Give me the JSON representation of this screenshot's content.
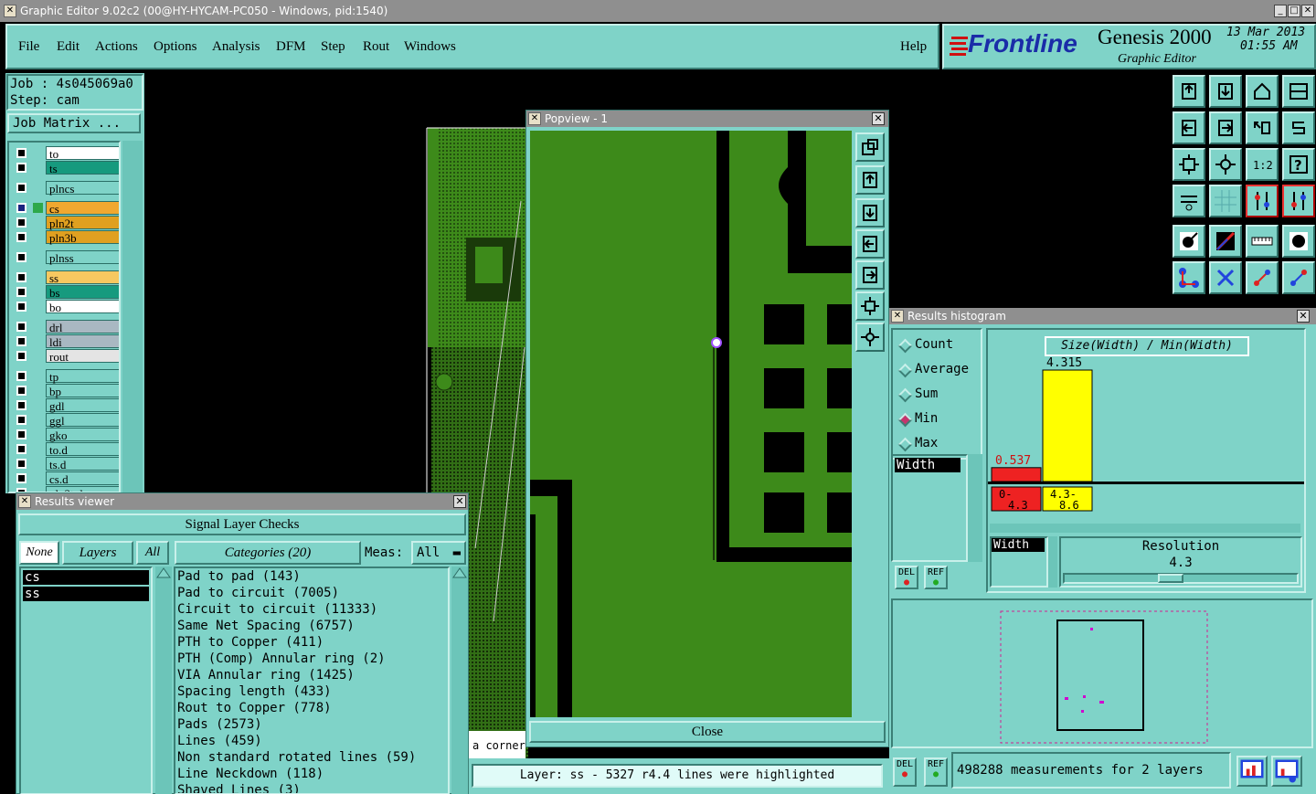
{
  "window": {
    "title": "Graphic Editor 9.02c2 (00@HY-HYCAM-PC050 - Windows, pid:1540)"
  },
  "menu": {
    "file": "File",
    "edit": "Edit",
    "actions": "Actions",
    "options": "Options",
    "analysis": "Analysis",
    "dfm": "DFM",
    "step": "Step",
    "rout": "Rout",
    "windows": "Windows",
    "help": "Help"
  },
  "brand": {
    "logo": "Frontline",
    "product": "Genesis 2000",
    "subtitle": "Graphic Editor",
    "date": "13 Mar 2013",
    "time": "01:55 AM"
  },
  "job": {
    "job_label": "Job : 4s045069a0",
    "step_label": "Step: cam",
    "matrix_button": "Job Matrix ..."
  },
  "layers": [
    {
      "name": "to",
      "color": "#ffffff",
      "selected": false
    },
    {
      "name": "ts",
      "color": "#169a7e",
      "selected": false
    },
    {
      "name": "plncs",
      "color": "#7fd3c8",
      "selected": false
    },
    {
      "name": "cs",
      "color": "#f0a830",
      "selected": true
    },
    {
      "name": "pln2t",
      "color": "#e0a020",
      "selected": false
    },
    {
      "name": "pln3b",
      "color": "#e0a020",
      "selected": false
    },
    {
      "name": "plnss",
      "color": "#7fd3c8",
      "selected": false
    },
    {
      "name": "ss",
      "color": "#f7c860",
      "selected": false
    },
    {
      "name": "bs",
      "color": "#169a7e",
      "selected": false
    },
    {
      "name": "bo",
      "color": "#ffffff",
      "selected": false
    },
    {
      "name": "drl",
      "color": "#a9b8c2",
      "selected": false
    },
    {
      "name": "ldi",
      "color": "#a9b8c2",
      "selected": false
    },
    {
      "name": "rout",
      "color": "#e4e4e4",
      "selected": false
    },
    {
      "name": "tp",
      "color": "#7fd3c8",
      "selected": false
    },
    {
      "name": "bp",
      "color": "#7fd3c8",
      "selected": false
    },
    {
      "name": "gdl",
      "color": "#7fd3c8",
      "selected": false
    },
    {
      "name": "ggl",
      "color": "#7fd3c8",
      "selected": false
    },
    {
      "name": "gko",
      "color": "#7fd3c8",
      "selected": false
    },
    {
      "name": "to.d",
      "color": "#7fd3c8",
      "selected": false
    },
    {
      "name": "ts.d",
      "color": "#7fd3c8",
      "selected": false
    },
    {
      "name": "cs.d",
      "color": "#7fd3c8",
      "selected": false
    },
    {
      "name": "pln2t.d",
      "color": "#7fd3c8",
      "selected": false
    }
  ],
  "results_viewer": {
    "title": "Results viewer",
    "header": "Signal Layer Checks",
    "none_button": "None",
    "layers_label": "Layers",
    "all_button": "All",
    "categories_label": "Categories (20)",
    "meas_label": "Meas:",
    "meas_value": "All",
    "layer_items": [
      "cs",
      "ss"
    ],
    "categories": [
      "Pad to pad (143)",
      "Pad to circuit (7005)",
      "Circuit to circuit (11333)",
      "Same Net Spacing (6757)",
      "PTH to Copper (411)",
      "PTH (Comp) Annular ring (2)",
      "VIA Annular ring (1425)",
      "Spacing length (433)",
      "Rout to Copper (778)",
      "Pads (2573)",
      "Lines (459)",
      "Non standard rotated lines (59)",
      "Line Neckdown (118)",
      "Shaved Lines (3)"
    ]
  },
  "popview": {
    "title": "Popview - 1",
    "close_button": "Close"
  },
  "status": {
    "message": "Layer: ss - 5327 r4.4 lines were highlighted",
    "fragment": "a corner"
  },
  "histogram": {
    "title": "Results histogram",
    "modes": [
      "Count",
      "Average",
      "Sum",
      "Min",
      "Max"
    ],
    "selected_mode": "Min",
    "metric_item": "Width",
    "chart_label": "Size(Width) / Min(Width)",
    "bars": [
      {
        "label": "0-4.3",
        "value": 0.537,
        "display": "0.537",
        "color": "#ee2222"
      },
      {
        "label": "4.3-8.6",
        "value": 4.315,
        "display": "4.315",
        "color": "#ffff00"
      }
    ],
    "width_item": "Width",
    "resolution_label": "Resolution",
    "resolution_value": "4.3",
    "resolution_fraction": 0.45,
    "measurements": "498288 measurements for 2 layers",
    "del_label": "DEL",
    "ref_label": "REF"
  }
}
